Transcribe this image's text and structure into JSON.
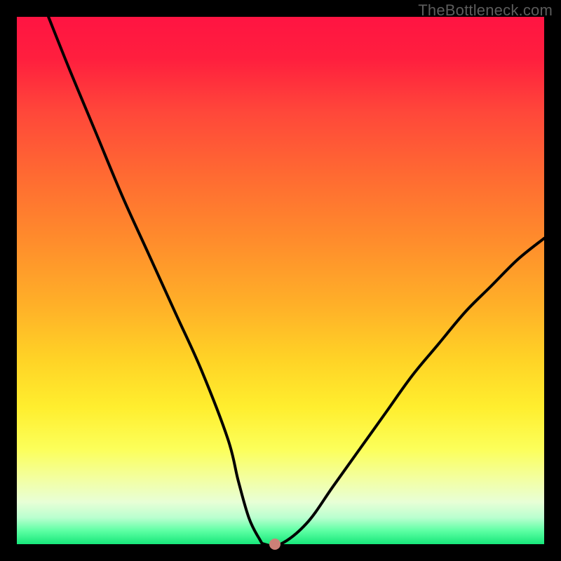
{
  "watermark": "TheBottleneck.com",
  "colors": {
    "frame": "#000000",
    "curve": "#000000",
    "marker": "#cc8077",
    "gradient_stops": [
      "#ff1442",
      "#ff473a",
      "#ff8b2c",
      "#ffd326",
      "#fcff5a",
      "#e8ffd6",
      "#5cffa3",
      "#17e77a"
    ]
  },
  "chart_data": {
    "type": "line",
    "title": "",
    "xlabel": "",
    "ylabel": "",
    "xlim": [
      0,
      100
    ],
    "ylim": [
      0,
      100
    ],
    "grid": false,
    "legend": false,
    "series": [
      {
        "name": "bottleneck-curve",
        "x": [
          6,
          10,
          15,
          20,
          25,
          30,
          35,
          40,
          42,
          44,
          46,
          47,
          50,
          55,
          60,
          65,
          70,
          75,
          80,
          85,
          90,
          95,
          100
        ],
        "values": [
          100,
          90,
          78,
          66,
          55,
          44,
          33,
          20,
          12,
          5,
          1,
          0,
          0,
          4,
          11,
          18,
          25,
          32,
          38,
          44,
          49,
          54,
          58
        ]
      }
    ],
    "annotations": [
      {
        "name": "optimum-marker",
        "x": 49,
        "y": 0
      }
    ]
  }
}
